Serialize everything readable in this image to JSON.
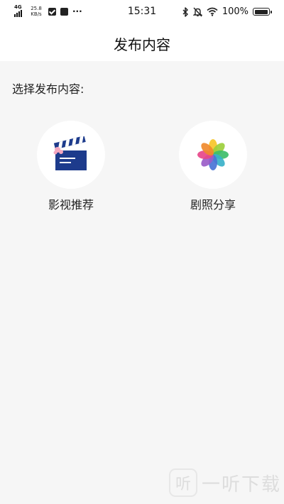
{
  "status_bar": {
    "network": "4G",
    "speed_value": "25.8",
    "speed_unit": "KB/s",
    "more": "···",
    "time": "15:31",
    "battery_percent": "100%",
    "battery_level": 1.0
  },
  "header": {
    "title": "发布内容"
  },
  "main": {
    "select_label": "选择发布内容:",
    "options": [
      {
        "label": "影视推荐",
        "icon": "clapperboard-icon"
      },
      {
        "label": "剧照分享",
        "icon": "photos-flower-icon"
      }
    ]
  },
  "watermark": {
    "logo": "听",
    "text": "一听下载"
  }
}
